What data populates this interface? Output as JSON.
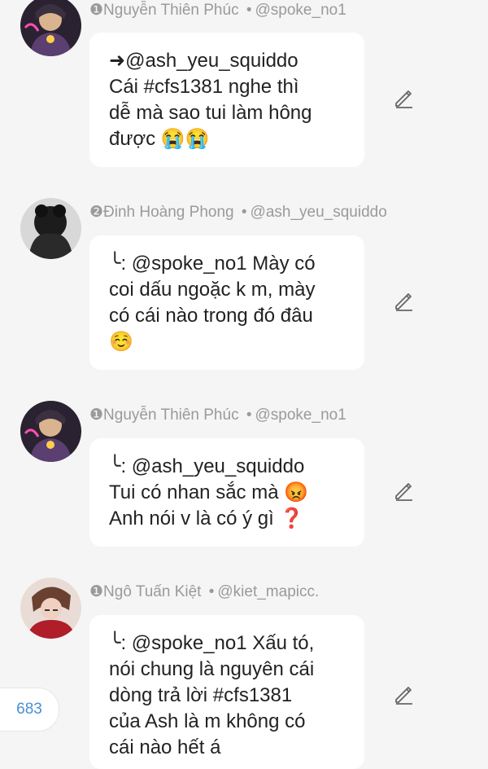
{
  "comments": [
    {
      "author_name": "❶Nguyễn Thiên Phúc",
      "handle": "@spoke_no1",
      "separator": "•",
      "lines": [
        "➜@ash_yeu_squiddo",
        "Cái #cfs1381 nghe thì",
        "dễ mà sao tui làm hông",
        "được 😭😭"
      ]
    },
    {
      "author_name": "❷Đinh Hoàng Phong",
      "handle": "@ash_yeu_squiddo",
      "separator": "•",
      "lines": [
        "╰: @spoke_no1 Mày có",
        "coi dấu ngoặc k m, mày",
        "có cái nào trong đó đâu",
        "☺️"
      ]
    },
    {
      "author_name": "❶Nguyễn Thiên Phúc",
      "handle": "@spoke_no1",
      "separator": "•",
      "lines": [
        "╰: @ash_yeu_squiddo",
        "Tui có nhan sắc mà 😡",
        "Anh nói v là có ý gì ❓"
      ]
    },
    {
      "author_name": "❶Ngô Tuấn Kiệt",
      "handle": "@kiet_mapicc.",
      "separator": "•",
      "lines": [
        "╰: @spoke_no1 Xấu tó,",
        "nói chung là nguyên cái",
        "dòng trả lời #cfs1381",
        "của Ash là m không có",
        "cái nào hết á"
      ]
    }
  ],
  "counter": "683",
  "icons": {
    "edit": "pencil-edit-icon"
  },
  "colors": {
    "background": "#f5f5f5",
    "bubble": "#ffffff",
    "author": "#9a9a9a",
    "counter": "#4a8fd6"
  }
}
